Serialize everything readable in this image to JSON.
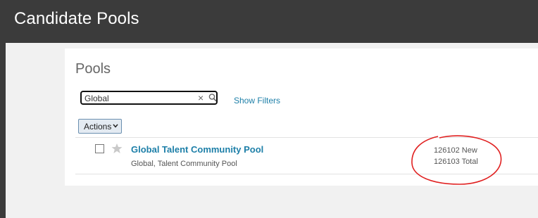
{
  "page": {
    "title": "Candidate Pools"
  },
  "pools": {
    "heading": "Pools",
    "search": {
      "value": "Global"
    },
    "show_filters_label": "Show Filters",
    "actions_label": "Actions",
    "rows": [
      {
        "name": "Global Talent Community Pool",
        "description": "Global, Talent Community Pool",
        "new_count_text": "126102 New",
        "total_count_text": "126103 Total"
      }
    ]
  },
  "icons": {
    "clear": "close-icon",
    "search": "search-icon",
    "star": "star-icon",
    "chevron": "chevron-down-icon"
  },
  "colors": {
    "header_bg": "#3b3b3b",
    "link": "#1d7fa8",
    "annotation": "#e02020"
  }
}
